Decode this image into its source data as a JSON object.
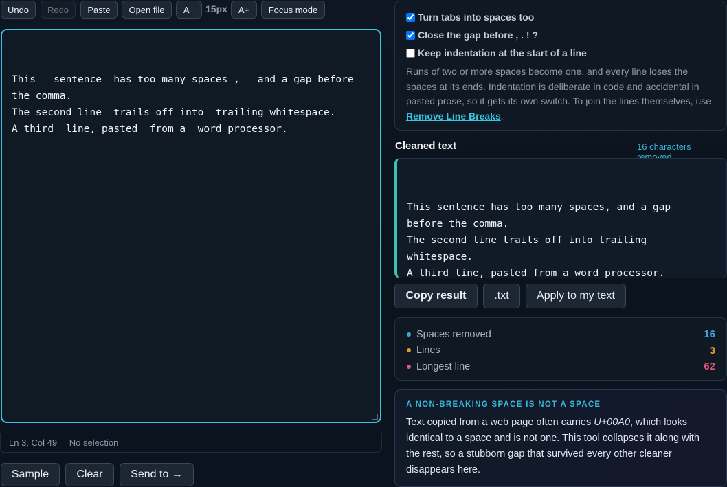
{
  "toolbar": {
    "undo": "Undo",
    "redo": "Redo",
    "paste": "Paste",
    "open_file": "Open file",
    "font_smaller": "A−",
    "font_size": "15px",
    "font_larger": "A+",
    "focus_mode": "Focus mode"
  },
  "editor": {
    "text": "This   sentence  has too many spaces ,   and a gap before\nthe comma.\nThe second line  trails off into  trailing whitespace.\nA third  line, pasted  from a  word processor."
  },
  "status": {
    "position": "Ln 3, Col 49",
    "selection": "No selection"
  },
  "bottom_buttons": {
    "sample": "Sample",
    "clear": "Clear",
    "send_to": "Send to →"
  },
  "options": {
    "tabs_label": "Turn tabs into spaces too",
    "tabs_checked": true,
    "punct_label": "Close the gap before , . ! ?",
    "punct_checked": true,
    "indent_label": "Keep indentation at the start of a line",
    "indent_checked": false,
    "description": "Runs of two or more spaces become one, and every line loses the spaces at its ends. Indentation is deliberate in code and accidental in pasted prose, so it gets its own switch. To join the lines themselves, use ",
    "link_text": "Remove Line Breaks",
    "description_end": "."
  },
  "result": {
    "title": "Cleaned text",
    "removed_badge": "16 characters removed",
    "text": "This sentence has too many spaces, and a gap\nbefore the comma.\nThe second line trails off into trailing\nwhitespace.\nA third line, pasted from a word processor.",
    "copy": "Copy result",
    "txt": ".txt",
    "apply": "Apply to my text"
  },
  "stats": [
    {
      "label": "Spaces removed",
      "value": "16",
      "color": "#3aa7d6"
    },
    {
      "label": "Lines",
      "value": "3",
      "color": "#e49a2c"
    },
    {
      "label": "Longest line",
      "value": "62",
      "color": "#e6557a"
    }
  ],
  "tip": {
    "heading": "A NON-BREAKING SPACE IS NOT A SPACE",
    "body_before": "Text copied from a web page often carries ",
    "code": "U+00A0",
    "body_after": ", which looks identical to a space and is not one. This tool collapses it along with the rest, so a stubborn gap that survived every other cleaner disappears here."
  }
}
